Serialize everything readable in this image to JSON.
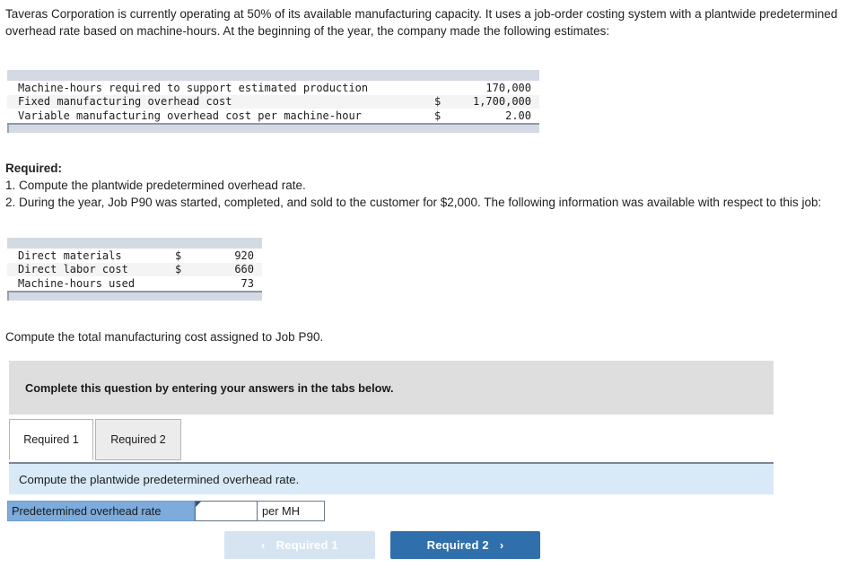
{
  "intro": {
    "paragraph": "Taveras Corporation is currently operating at 50% of its available manufacturing capacity. It uses a job-order costing system with a plantwide predetermined overhead rate based on machine-hours. At the beginning of the year, the company made the following estimates:"
  },
  "estimates_table": {
    "rows": [
      {
        "label": "Machine-hours required to support estimated production",
        "currency": "",
        "value": "170,000"
      },
      {
        "label": "Fixed manufacturing overhead cost",
        "currency": "$",
        "value": "1,700,000"
      },
      {
        "label": "Variable manufacturing overhead cost per machine-hour",
        "currency": "$",
        "value": "2.00"
      }
    ]
  },
  "required": {
    "title": "Required:",
    "item1": "1. Compute the plantwide predetermined overhead rate.",
    "item2": "2. During the year, Job P90 was started, completed, and sold to the customer for $2,000. The following information was available with respect to this job:"
  },
  "job_table": {
    "rows": [
      {
        "label": "Direct materials",
        "currency": "$",
        "value": "920"
      },
      {
        "label": "Direct labor cost",
        "currency": "$",
        "value": "660"
      },
      {
        "label": "Machine-hours used",
        "currency": "",
        "value": "73"
      }
    ]
  },
  "compute_line": "Compute the total manufacturing cost assigned to Job P90.",
  "instruction_banner": {
    "text": "Complete this question by entering your answers in the tabs below."
  },
  "tabs": [
    {
      "label": "Required 1",
      "active": true
    },
    {
      "label": "Required 2",
      "active": false
    }
  ],
  "sub_instruction": {
    "text": "Compute the plantwide predetermined overhead rate."
  },
  "answer_row": {
    "label": "Predetermined overhead rate",
    "value": "",
    "placeholder": "",
    "unit": "per MH"
  },
  "nav": {
    "prev_label": "Required 1",
    "prev_chevron": "‹",
    "next_label": "Required 2",
    "next_chevron": "›"
  },
  "colors": {
    "banner_grey": "#dededf",
    "banner_blue": "#d8eaf8",
    "label_blue": "#7cabdc",
    "button_active": "#2f6fab",
    "button_disabled": "#d6e4f2",
    "table_band": "#d4dae3"
  }
}
